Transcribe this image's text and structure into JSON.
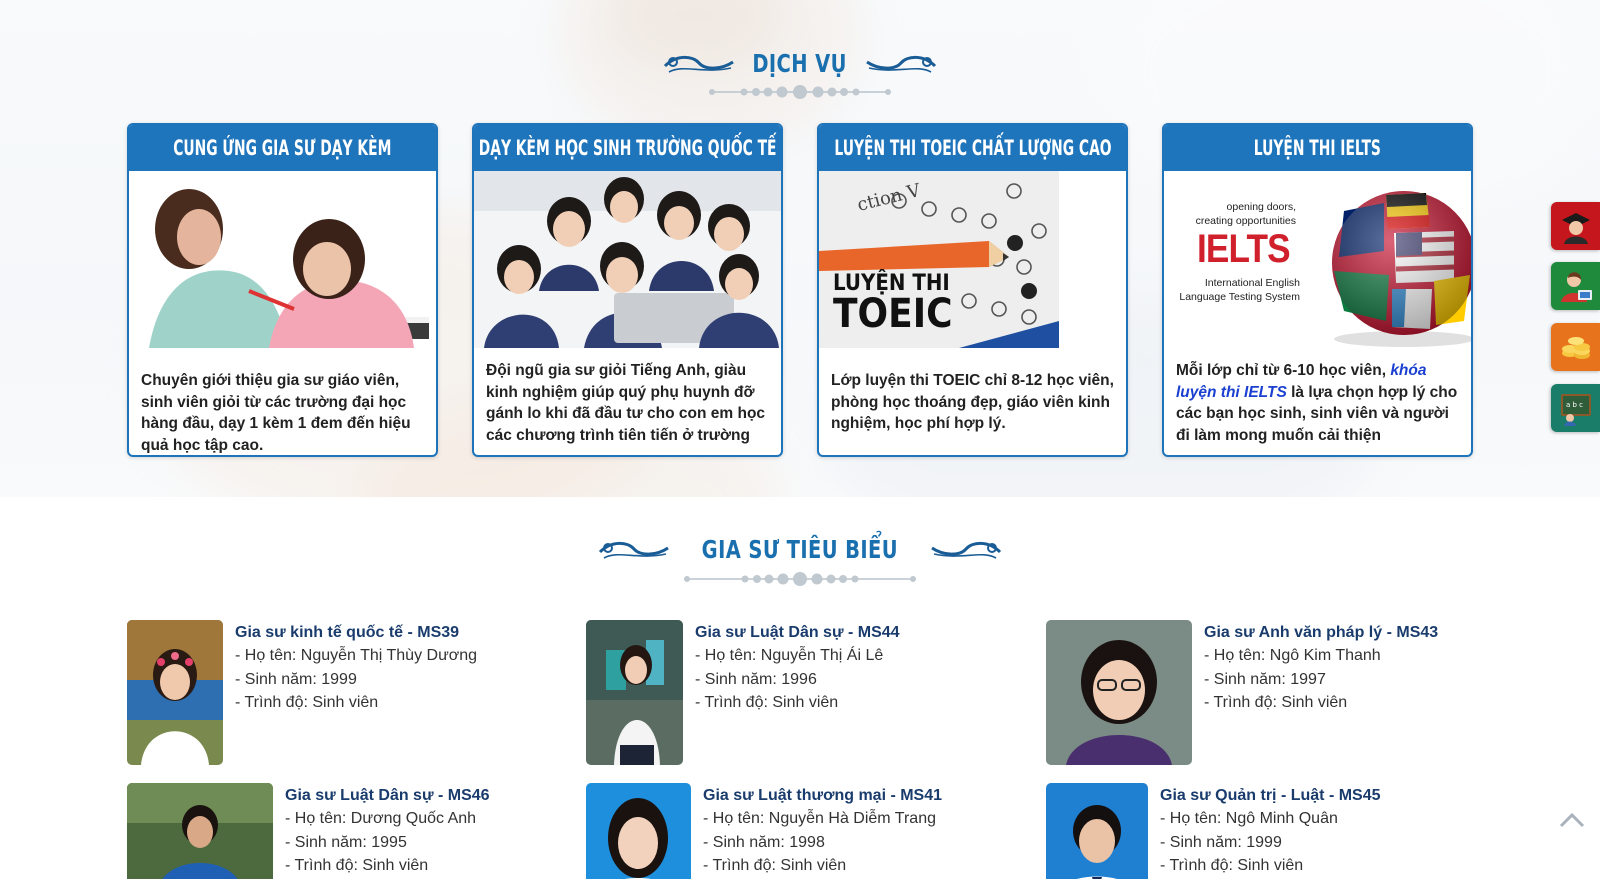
{
  "services": {
    "title": "DỊCH VỤ",
    "cards": [
      {
        "title": "CUNG ỨNG GIA SƯ DẠY KÈM",
        "text": "Chuyên giới thiệu gia sư giáo viên, sinh viên giỏi từ các trường đại học hàng đầu, dạy 1 kèm 1 đem đến hiệu quả học tập cao."
      },
      {
        "title": "DẠY KÈM HỌC SINH TRƯỜNG QUỐC TẾ",
        "text": "Đội ngũ gia sư giỏi Tiếng Anh, giàu kinh nghiệm giúp quý phụ huynh đỡ gánh lo khi đã đầu tư cho con em học các chương trình tiên tiến ở trường"
      },
      {
        "title": "LUYỆN THI TOEIC CHẤT LƯỢNG CAO",
        "text": "Lớp luyện thi TOEIC chỉ 8-12 học viên, phòng học thoáng đẹp, giáo viên kinh nghiệm, học phí hợp lý.",
        "image_caption_1": "LUYỆN THI",
        "image_caption_2": "TOEIC"
      },
      {
        "title": "LUYỆN THI IELTS",
        "text_before": "Mỗi lớp chỉ từ 6-10 học viên, ",
        "text_link": "khóa luyện thi IELTS",
        "text_after": " là lựa chọn hợp lý cho các bạn học sinh, sinh viên và người đi làm mong muốn cải thiện",
        "image_line_1": "opening doors,",
        "image_line_2": "creating opportunities",
        "image_logo": "IELTS",
        "image_line_3": "International English",
        "image_line_4": "Language Testing System"
      }
    ]
  },
  "tutors": {
    "title": "GIA SƯ TIÊU BIỂU",
    "items": [
      {
        "name": "Gia sư kinh tế quốc tế - MS39",
        "fullname": "- Họ tên: Nguyễn Thị Thùy Dương",
        "birth": "- Sinh năm: 1999",
        "level": "- Trình độ: Sinh viên"
      },
      {
        "name": "Gia sư Luật Dân sự - MS44",
        "fullname": "- Họ tên: Nguyễn Thị Ái Lê",
        "birth": "- Sinh năm: 1996",
        "level": "- Trình độ: Sinh viên"
      },
      {
        "name": "Gia sư Anh văn pháp lý - MS43",
        "fullname": "- Họ tên: Ngô Kim Thanh",
        "birth": "- Sinh năm: 1997",
        "level": "- Trình độ: Sinh viên"
      },
      {
        "name": "Gia sư Luật Dân sự - MS46",
        "fullname": "- Họ tên: Dương Quốc Anh",
        "birth": "- Sinh năm: 1995",
        "level": "- Trình độ: Sinh viên"
      },
      {
        "name": "Gia sư Luật thương mại - MS41",
        "fullname": "- Họ tên: Nguyễn Hà Diễm Trang",
        "birth": "- Sinh năm: 1998",
        "level": "- Trình độ: Sinh viên"
      },
      {
        "name": "Gia sư Quản trị - Luật - MS45",
        "fullname": "- Họ tên: Ngô Minh Quân",
        "birth": "- Sinh năm: 1999",
        "level": "- Trình độ: Sinh viên"
      }
    ]
  },
  "float_buttons": [
    {
      "icon": "graduate-icon",
      "color": "#c4161c"
    },
    {
      "icon": "tutor-icon",
      "color": "#1f8a3c"
    },
    {
      "icon": "coins-icon",
      "color": "#e8731d"
    },
    {
      "icon": "blackboard-icon",
      "color": "#1a7d6a"
    }
  ],
  "colors": {
    "accent": "#1f75bc",
    "title": "#1a6fae",
    "tutor_name": "#1a3c6d",
    "link": "#1a3fd1"
  }
}
